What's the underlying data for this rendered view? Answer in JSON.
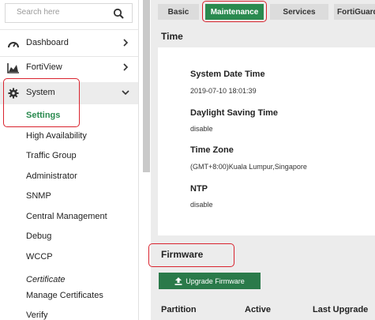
{
  "search": {
    "placeholder": "Search here"
  },
  "sidebar": {
    "items": [
      {
        "label": "Dashboard",
        "icon": "dashboard-icon"
      },
      {
        "label": "FortiView",
        "icon": "chart-icon"
      },
      {
        "label": "System",
        "icon": "gear-icon"
      }
    ],
    "system_children": [
      "Settings",
      "High Availability",
      "Traffic Group",
      "Administrator",
      "SNMP",
      "Central Management",
      "Debug",
      "WCCP"
    ],
    "certificate_section": "Certificate",
    "certificate_children": [
      "Manage Certificates",
      "Verify"
    ]
  },
  "tabs": [
    "Basic",
    "Maintenance",
    "Services",
    "FortiGuard"
  ],
  "active_tab": "Maintenance",
  "time_section": {
    "title": "Time",
    "fields": [
      {
        "label": "System Date Time",
        "value": "2019-07-10 18:01:39"
      },
      {
        "label": "Daylight Saving Time",
        "value": "disable"
      },
      {
        "label": "Time Zone",
        "value": "(GMT+8:00)Kuala Lumpur,Singapore"
      },
      {
        "label": "NTP",
        "value": "disable"
      }
    ]
  },
  "firmware": {
    "title": "Firmware",
    "upgrade_button": "Upgrade Firmware",
    "columns": [
      "Partition",
      "Active",
      "Last Upgrade"
    ]
  },
  "colors": {
    "accent": "#2a8a4f",
    "button": "#2a7a4a",
    "annotation": "#d9232e"
  }
}
